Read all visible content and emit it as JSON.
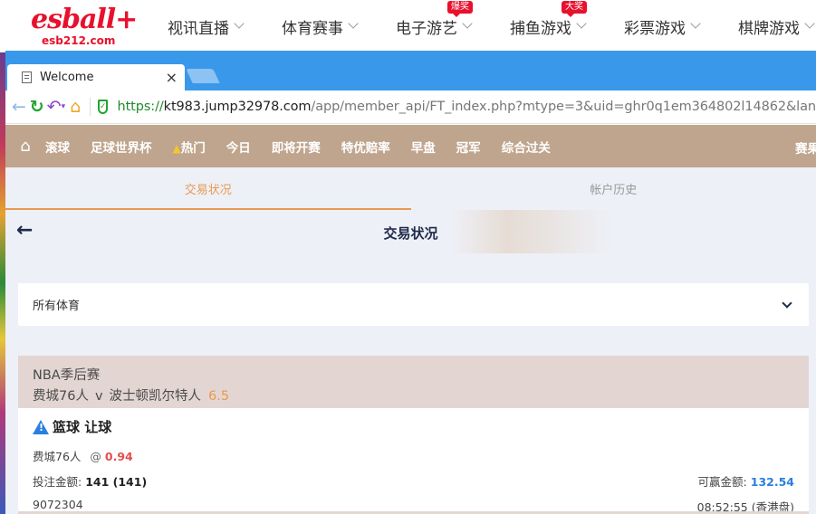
{
  "site": {
    "logo_text": "esball+",
    "logo_sub": "esb212.com",
    "nav": [
      {
        "label": "视讯直播",
        "badge": ""
      },
      {
        "label": "体育赛事",
        "badge": ""
      },
      {
        "label": "电子游艺",
        "badge": "爆奖"
      },
      {
        "label": "捕鱼游戏",
        "badge": "大奖"
      },
      {
        "label": "彩票游戏",
        "badge": ""
      },
      {
        "label": "棋牌游戏",
        "badge": ""
      }
    ]
  },
  "browser": {
    "tab_title": "Welcome",
    "tab_close": "×",
    "url_proto": "https://",
    "url_host": "kt983.jump32978.com",
    "url_path": "/app/member_api/FT_index.php?mtype=3&uid=ghr0q1em364802l14862&lan"
  },
  "menu": {
    "items": [
      "滚球",
      "足球世界杯",
      "热门",
      "今日",
      "即将开赛",
      "特优赔率",
      "早盘",
      "冠军",
      "综合过关"
    ],
    "results": "赛果"
  },
  "subtabs": [
    "交易状况",
    "帐户历史"
  ],
  "page": {
    "title": "交易状况",
    "filter_label": "所有体育"
  },
  "bet": {
    "league": "NBA季后赛",
    "home": "费城76人",
    "vs": "v",
    "away": "波士顿凯尔特人",
    "handicap": "6.5",
    "market": "篮球 让球",
    "selection": "费城76人",
    "at": "@",
    "odds": "0.94",
    "stake_label": "投注金额:",
    "stake": "141 (141)",
    "win_label": "可赢金额:",
    "win": "132.54",
    "ticket_id": "9072304",
    "time": "08:52:55 (香港盘)"
  },
  "colors": {
    "brand": "#e8112d",
    "tab_bar": "#3a98ea",
    "menu_bg": "#bfa58d",
    "accent": "#e79a51",
    "odds": "#e54d4d",
    "win": "#2a7fe0"
  }
}
